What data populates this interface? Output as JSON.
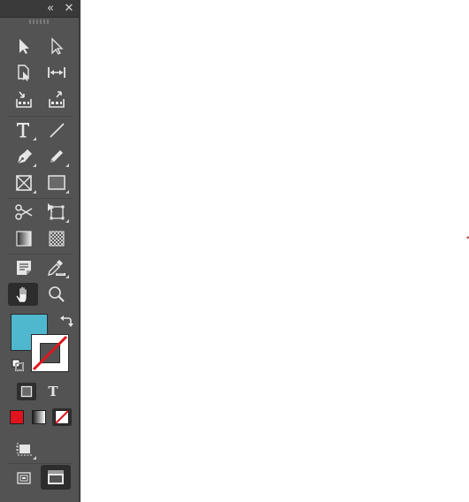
{
  "panel": {
    "title_buttons": {
      "collapse_glyph": "«",
      "close_glyph": "✕"
    }
  },
  "tools": [
    {
      "name": "selection-tool-icon"
    },
    {
      "name": "direct-selection-tool-icon"
    },
    {
      "name": "page-tool-icon"
    },
    {
      "name": "gap-tool-icon"
    },
    {
      "name": "content-collector-icon"
    },
    {
      "name": "content-placer-icon"
    },
    {
      "name": "type-tool-icon"
    },
    {
      "name": "line-tool-icon"
    },
    {
      "name": "pen-tool-icon"
    },
    {
      "name": "pencil-tool-icon"
    },
    {
      "name": "rectangle-frame-tool-icon"
    },
    {
      "name": "rectangle-tool-icon"
    },
    {
      "name": "scissors-tool-icon"
    },
    {
      "name": "free-transform-tool-icon"
    },
    {
      "name": "gradient-swatch-tool-icon"
    },
    {
      "name": "gradient-feather-tool-icon"
    },
    {
      "name": "note-tool-icon"
    },
    {
      "name": "eyedropper-tool-icon"
    },
    {
      "name": "hand-tool-icon",
      "active": true
    },
    {
      "name": "zoom-tool-icon"
    }
  ],
  "swatches": {
    "fill_color": "#4fb8cf",
    "stroke": "none",
    "type_label": "T",
    "apply_color": "#e0141e",
    "apply_none_slash": "#e0141e"
  }
}
